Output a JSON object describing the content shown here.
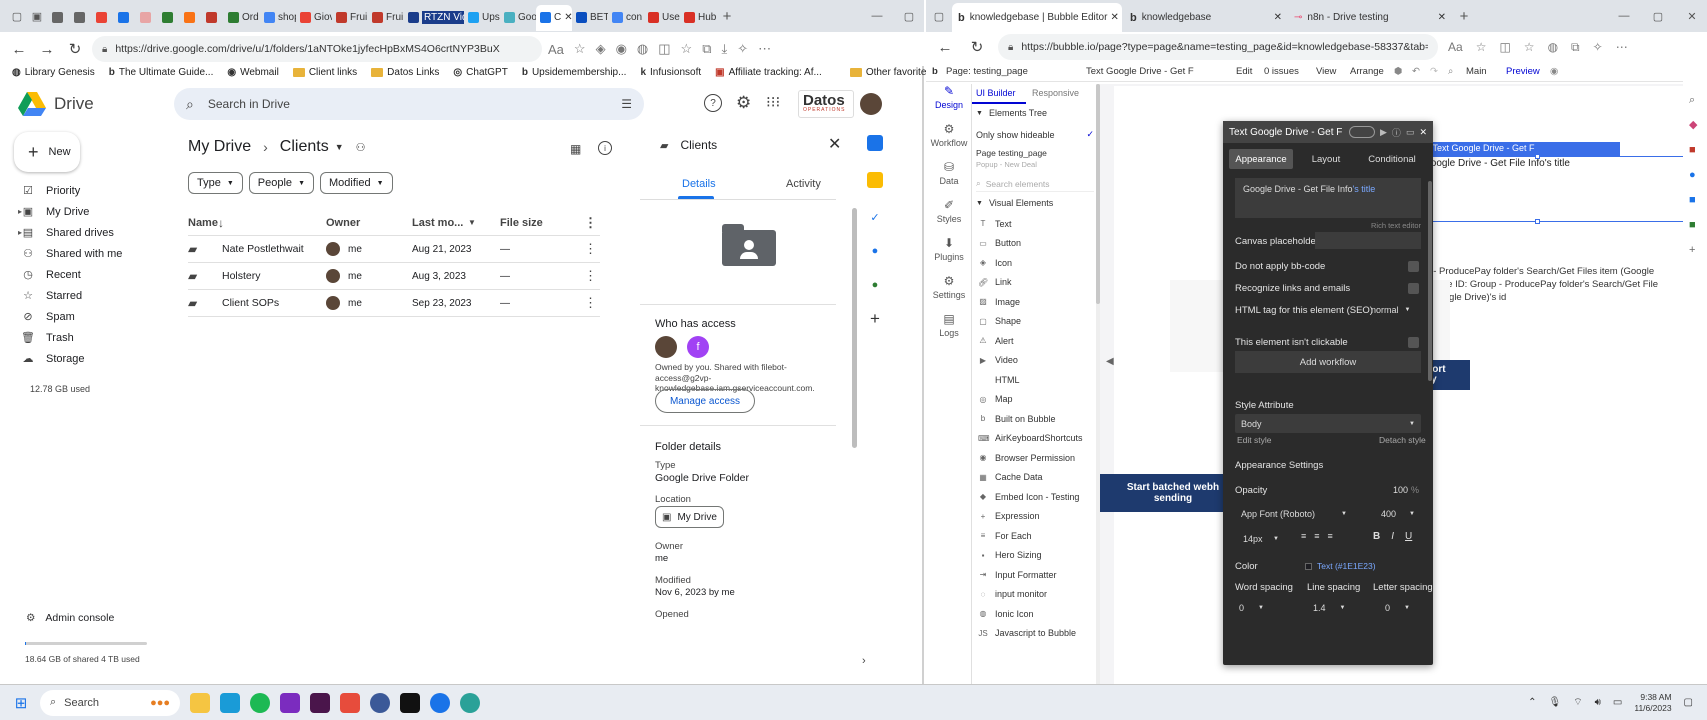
{
  "left": {
    "tabs": [
      {
        "label": "",
        "color": "#666"
      },
      {
        "label": "",
        "color": "#666"
      },
      {
        "label": "",
        "color": "#ea4335"
      },
      {
        "label": "",
        "color": "#1a73e8"
      },
      {
        "label": "",
        "color": "#e8a5a5"
      },
      {
        "label": "",
        "color": "#2e7d32"
      },
      {
        "label": "",
        "color": "#f97316"
      },
      {
        "label": "",
        "color": "#c0392b"
      },
      {
        "label": "Ord",
        "color": "#2e7d32"
      },
      {
        "label": "shop",
        "color": "#4285f4"
      },
      {
        "label": "Giov",
        "color": "#ea4335"
      },
      {
        "label": "Frui",
        "color": "#c0392b"
      },
      {
        "label": "Frui",
        "color": "#c0392b"
      },
      {
        "label": "RTZN Videos",
        "color": "#1a3c8a"
      },
      {
        "label": "Ups",
        "color": "#1da1f2"
      },
      {
        "label": "Goo",
        "color": "#4ab0c1"
      },
      {
        "label": "C",
        "color": "#1a73e8"
      },
      {
        "label": "BETI",
        "color": "#0a4ebf"
      },
      {
        "label": "con",
        "color": "#4285f4"
      },
      {
        "label": "Use",
        "color": "#d93025"
      },
      {
        "label": "Hub",
        "color": "#d93025"
      }
    ],
    "url": "https://drive.google.com/drive/u/1/folders/1aNTOke1jyfecHpBxMS4O6crtNYP3BuX",
    "bookmarks": [
      {
        "label": "Library Genesis",
        "type": "globe"
      },
      {
        "label": "The Ultimate Guide...",
        "type": "b"
      },
      {
        "label": "Webmail",
        "type": "w"
      },
      {
        "label": "Client links",
        "type": "folder"
      },
      {
        "label": "Datos Links",
        "type": "folder"
      },
      {
        "label": "ChatGPT",
        "type": "g"
      },
      {
        "label": "Upsidemembership...",
        "type": "b"
      },
      {
        "label": "Infusionsoft",
        "type": "k"
      },
      {
        "label": "Affiliate tracking: Af...",
        "type": "a"
      }
    ],
    "other_favorites": "Other favorites",
    "drive": {
      "logo_text": "Drive",
      "search_placeholder": "Search in Drive",
      "brand": "Datos",
      "brand_sub": "OPERATIONS",
      "new_label": "New",
      "nav": [
        {
          "label": "Priority",
          "icon": "priority-icon"
        },
        {
          "label": "My Drive",
          "icon": "my-drive-icon"
        },
        {
          "label": "Shared drives",
          "icon": "shared-drives-icon"
        },
        {
          "label": "Shared with me",
          "icon": "shared-with-me-icon"
        },
        {
          "label": "Recent",
          "icon": "clock-icon"
        },
        {
          "label": "Starred",
          "icon": "star-icon"
        },
        {
          "label": "Spam",
          "icon": "spam-icon"
        },
        {
          "label": "Trash",
          "icon": "trash-icon"
        },
        {
          "label": "Storage",
          "icon": "cloud-icon"
        }
      ],
      "storage_used": "12.78 GB used",
      "admin_console": "Admin console",
      "shared_storage": "18.64 GB of shared 4 TB used",
      "breadcrumb": {
        "root": "My Drive",
        "current": "Clients"
      },
      "filters": [
        "Type",
        "People",
        "Modified"
      ],
      "columns": {
        "name": "Name",
        "owner": "Owner",
        "last_modified": "Last mo...",
        "file_size": "File size"
      },
      "files": [
        {
          "name": "Nate Postlethwait",
          "owner": "me",
          "modified": "Aug 21, 2023",
          "size": "—"
        },
        {
          "name": "Holstery",
          "owner": "me",
          "modified": "Aug 3, 2023",
          "size": "—"
        },
        {
          "name": "Client SOPs",
          "owner": "me",
          "modified": "Sep 23, 2023",
          "size": "—"
        }
      ],
      "details": {
        "title": "Clients",
        "tab_details": "Details",
        "tab_activity": "Activity",
        "who_has_access": "Who has access",
        "access_avatar_letter": "f",
        "access_text": "Owned by you. Shared with filebot-access@g2vp-knowledgebase.iam.gserviceaccount.com.",
        "manage_access": "Manage access",
        "folder_details": "Folder details",
        "type_label": "Type",
        "type_value": "Google Drive Folder",
        "location_label": "Location",
        "location_value": "My Drive",
        "owner_label": "Owner",
        "owner_value": "me",
        "modified_label": "Modified",
        "modified_value": "Nov 6, 2023 by me",
        "opened_label": "Opened"
      }
    }
  },
  "right": {
    "tabs": [
      {
        "label": "knowledgebase | Bubble Editor"
      },
      {
        "label": "knowledgebase"
      },
      {
        "label": "n8n - Drive testing"
      }
    ],
    "url": "https://bubble.io/page?type=page&name=testing_page&id=knowledgebase-58337&tab=t...",
    "toolbar": {
      "page": "Page: testing_page",
      "element": "Text Google Drive - Get F",
      "edit": "Edit",
      "issues": "0 issues",
      "view": "View",
      "arrange": "Arrange",
      "main": "Main",
      "preview": "Preview"
    },
    "rail": [
      "Design",
      "Workflow",
      "Data",
      "Styles",
      "Plugins",
      "Settings",
      "Logs"
    ],
    "panel": {
      "tab_ui": "UI Builder",
      "tab_responsive": "Responsive",
      "elements_tree": "Elements Tree",
      "only_hideable": "Only show hideable",
      "page_name": "Page testing_page",
      "popup": "Popup - New Deal",
      "search_placeholder": "Search elements",
      "visual_elements": "Visual Elements",
      "items": [
        "Text",
        "Button",
        "Icon",
        "Link",
        "Image",
        "Shape",
        "Alert",
        "Video",
        "HTML",
        "Map",
        "Built on Bubble",
        "AirKeyboardShortcuts",
        "Browser Permission",
        "Cache Data",
        "Embed Icon - Testing",
        "Expression",
        "For Each",
        "Hero Sizing",
        "Input Formatter",
        "input monitor",
        "Ionic Icon",
        "Javascript to Bubble"
      ]
    },
    "property_editor": {
      "title": "Text Google Drive - Get F",
      "tabs": [
        "Appearance",
        "Layout",
        "Conditional"
      ],
      "text_value_plain": "Google Drive - Get File Info",
      "text_value_dynamic": "'s title",
      "rich_text_editor": "Rich text editor",
      "canvas_placeholder": "Canvas placeholder",
      "no_bbcode": "Do not apply bb-code",
      "recognize_links": "Recognize links and emails",
      "html_tag": "HTML tag for this element (SEO)",
      "html_tag_value": "normal",
      "not_clickable": "This element isn't clickable",
      "add_workflow": "Add workflow",
      "style_attribute": "Style Attribute",
      "style_value": "Body",
      "edit_style": "Edit style",
      "detach_style": "Detach style",
      "appearance_settings": "Appearance Settings",
      "opacity_label": "Opacity",
      "opacity_value": "100",
      "opacity_unit": "%",
      "font": "App Font (Roboto)",
      "weight": "400",
      "size": "14px",
      "color_label": "Color",
      "color_value": "Text (#1E1E23)",
      "word_spacing": "Word spacing",
      "line_spacing": "Line spacing",
      "letter_spacing": "Letter spacing",
      "word_spacing_value": "0",
      "line_spacing_value": "1.4",
      "letter_spacing_value": "0"
    },
    "canvas": {
      "selected_label": "Text Google Drive - Get F",
      "selected_text": "Google Drive - Get File Info's title",
      "line1": "up - ProducePay folder's Search/Get Files item (Google",
      "line2": "e)'s title ID: Group - ProducePay folder's Search/Get File",
      "line3": "n (Google Drive)'s id",
      "button1": "e sort",
      "button1b": "ry",
      "button2": "Start batched webh",
      "button2b": "sending"
    }
  },
  "taskbar": {
    "search": "Search",
    "time": "9:38 AM",
    "date": "11/6/2023"
  }
}
